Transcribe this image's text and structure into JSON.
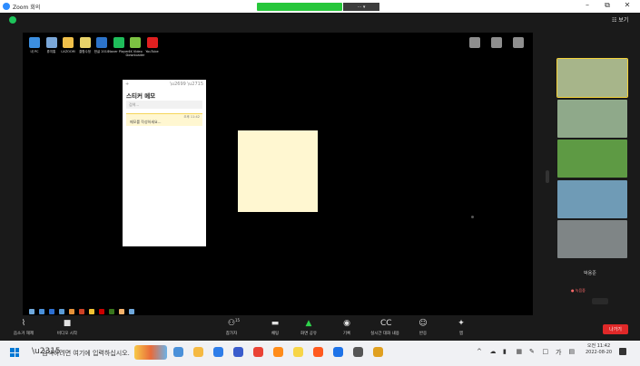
{
  "window": {
    "title": "Zoom 회의",
    "share_menu_label": "··· ▾"
  },
  "window_controls": {
    "minimize": "–",
    "restore": "⧉",
    "close": "✕"
  },
  "topbar": {
    "view_label": "☷ 보기"
  },
  "desktop_icons": [
    {
      "label": "내 PC",
      "color": "#3c8fe0"
    },
    {
      "label": "휴지통",
      "color": "#7aa7d8"
    },
    {
      "label": "LXZOOM",
      "color": "#f0c04a"
    },
    {
      "label": "결합수정",
      "color": "#e8d36a"
    },
    {
      "label": "한글 2010",
      "color": "#2c73c9"
    },
    {
      "label": "Naver Player",
      "color": "#1fbd5a"
    },
    {
      "label": "4K Video Downloader",
      "color": "#7cc242"
    },
    {
      "label": "YouTube",
      "color": "#e02020"
    }
  ],
  "sticky_notes": {
    "title": "스티커 메모",
    "search_placeholder": "검색...",
    "note_time": "오후 11:42",
    "note_text": "메모를 작성하세요..."
  },
  "gallery": {
    "thumbs": [
      {
        "tone": "#a7b58a",
        "active": true
      },
      {
        "tone": "#8fa98a"
      },
      {
        "tone": "#5e9a44"
      },
      {
        "tone": "#6f9bb6"
      },
      {
        "tone": "#7f8586"
      }
    ],
    "self_label": "박용준",
    "recording_label": "● 녹음중"
  },
  "controls": [
    {
      "id": "mute",
      "label": "음소거 해제",
      "icon": "⌇"
    },
    {
      "id": "video",
      "label": "비디오 시작",
      "icon": "■"
    },
    {
      "id": "participants",
      "label": "참가자",
      "icon": "⚇",
      "badge": "15"
    },
    {
      "id": "chat",
      "label": "채팅",
      "icon": "▬"
    },
    {
      "id": "share",
      "label": "화면 공유",
      "icon": "▲"
    },
    {
      "id": "record",
      "label": "기록",
      "icon": "◉"
    },
    {
      "id": "captions",
      "label": "실시간 대화 내용",
      "icon": "CC"
    },
    {
      "id": "reactions",
      "label": "반응",
      "icon": "☺"
    },
    {
      "id": "apps",
      "label": "앱",
      "icon": "✦"
    }
  ],
  "leave_label": "나가기",
  "taskbar": {
    "search_placeholder": "검색하려면 여기에 입력하십시오.",
    "apps": [
      "#4a90d9",
      "#f5b942",
      "#2e7de9",
      "#3a5ccc",
      "#ea4335",
      "#ff8c1a",
      "#f7d547",
      "#ff5a1f",
      "#1e73e8",
      "#555555",
      "#e0a020"
    ],
    "tray": [
      "^",
      "☁",
      "▮",
      "▦",
      "✎",
      "□",
      "가",
      "▤"
    ],
    "time": "오전 11:42",
    "date": "2022-08-20"
  }
}
